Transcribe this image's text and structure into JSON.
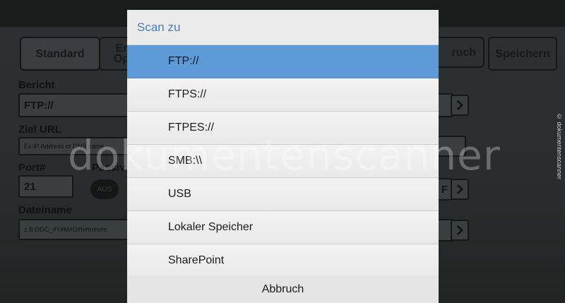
{
  "background": {
    "tabs": {
      "standard": "Standard",
      "ext_line1": "Er",
      "ext_line2": "Op",
      "abbruch_partial": "ruch",
      "speichern": "Speichern"
    },
    "fields": {
      "bericht_label": "Bericht",
      "bericht_value": "FTP://",
      "ziel_url_label": "Ziel URL",
      "ziel_url_placeholder": "Ex:IP Address or DNS name",
      "port_label": "Port#",
      "port_value": "21",
      "passiv_label": "Passiv",
      "passiv_toggle": "AUS",
      "dateiname_label": "Dateiname",
      "dateiname_placeholder": "z.B:DOC_#Y#M#D#h#m#s#n",
      "right_stub": "F"
    }
  },
  "dialog": {
    "title": "Scan zu",
    "options": [
      "FTP://",
      "FTPS://",
      "FTPES://",
      "SMB:\\\\",
      "USB",
      "Lokaler Speicher",
      "SharePoint"
    ],
    "selected_index": 0,
    "cancel_label": "Abbruch"
  },
  "watermark": "dokumentenscanner",
  "copyright": "© dokumentenscanner",
  "colors": {
    "dialog_title": "#4a7fb8",
    "selected_row": "#5e9ad8",
    "dim_background": "#2b2d2e"
  }
}
